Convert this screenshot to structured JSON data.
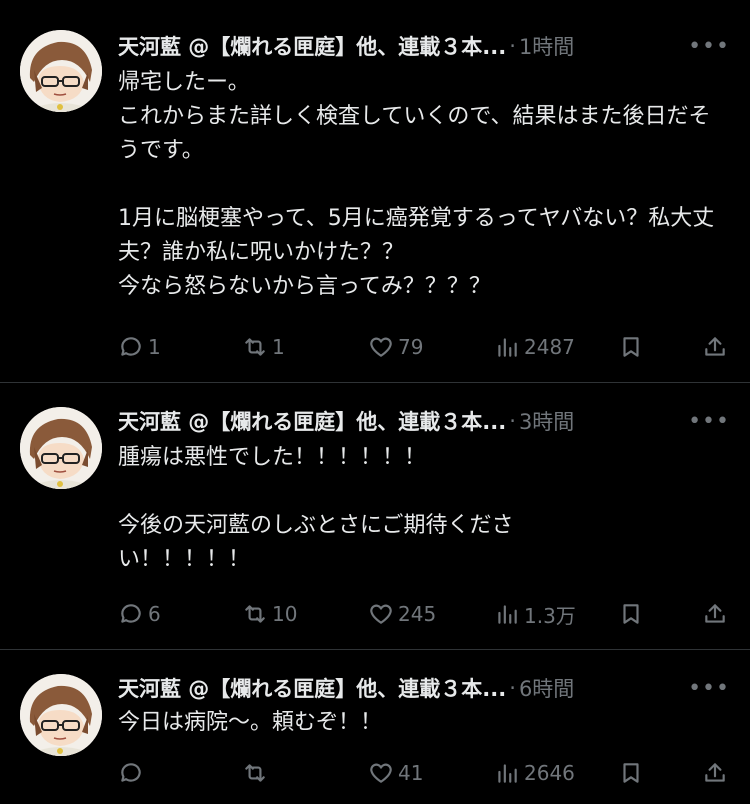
{
  "tweets": [
    {
      "author": "天河藍 @【爛れる匣庭】他、連載３本...",
      "dot": "·",
      "time": "1時間",
      "text": "帰宅したー。\nこれからまた詳しく検査していくので、結果はまた後日だそうです。\n\n1月に脳梗塞やって、5月に癌発覚するってヤバない？私大丈夫？誰か私に呪いかけた？？\n今なら怒らないから言ってみ？？？？",
      "replies": "1",
      "reposts": "1",
      "likes": "79",
      "views": "2487"
    },
    {
      "author": "天河藍 @【爛れる匣庭】他、連載３本...",
      "dot": "·",
      "time": "3時間",
      "text": "腫瘍は悪性でした！！！！！！\n\n今後の天河藍のしぶとさにご期待くださ\nい！！！！！",
      "replies": "6",
      "reposts": "10",
      "likes": "245",
      "views": "1.3万"
    },
    {
      "author": "天河藍 @【爛れる匣庭】他、連載３本...",
      "dot": "·",
      "time": "6時間",
      "text": "今日は病院〜。頼むぞ！！",
      "replies": "",
      "reposts": "",
      "likes": "41",
      "views": "2646"
    }
  ],
  "icons": {
    "more": "more-horizontal-icon",
    "reply": "speech-bubble-icon",
    "repost": "repost-arrows-icon",
    "like": "heart-icon",
    "views": "bar-chart-icon",
    "bookmark": "bookmark-icon",
    "share": "share-upload-icon"
  },
  "colors": {
    "background": "#000000",
    "text": "#e7e9ea",
    "secondary": "#71767b",
    "divider": "#2f3336"
  }
}
